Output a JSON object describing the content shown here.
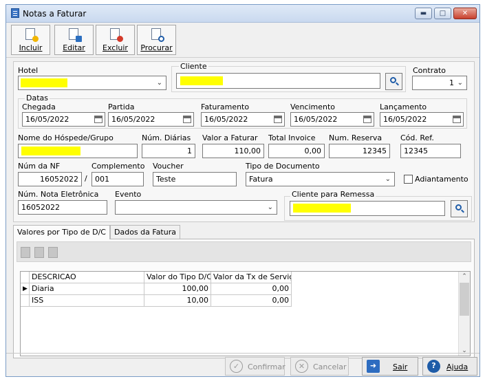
{
  "window": {
    "title": "Notas a Faturar",
    "minimize_icon": "minimize-icon",
    "maximize_icon": "maximize-icon",
    "close_icon": "close-icon"
  },
  "toolbar": {
    "incluir": "Incluir",
    "editar": "Editar",
    "excluir": "Excluir",
    "procurar": "Procurar"
  },
  "form": {
    "hotel_label": "Hotel",
    "cliente_label": "Cliente",
    "contrato_label": "Contrato",
    "contrato_value": "1",
    "datas_label": "Datas",
    "chegada_label": "Chegada",
    "chegada_value": "16/05/2022",
    "partida_label": "Partida",
    "partida_value": "16/05/2022",
    "faturamento_label": "Faturamento",
    "faturamento_value": "16/05/2022",
    "vencimento_label": "Vencimento",
    "vencimento_value": "16/05/2022",
    "lancamento_label": "Lançamento",
    "lancamento_value": "16/05/2022",
    "hospede_label": "Nome do Hóspede/Grupo",
    "diarias_label": "Núm. Diárias",
    "diarias_value": "1",
    "valor_label": "Valor a Faturar",
    "valor_value": "110,00",
    "total_label": "Total Invoice",
    "total_value": "0,00",
    "reserva_label": "Num. Reserva",
    "reserva_value": "12345",
    "codref_label": "Cód. Ref.",
    "codref_value": "12345",
    "nf_label": "Núm da NF",
    "nf_value": "16052022",
    "slash": "/",
    "complemento_label": "Complemento",
    "complemento_value": "001",
    "voucher_label": "Voucher",
    "voucher_value": "Teste",
    "tipo_doc_label": "Tipo de Documento",
    "tipo_doc_value": "Fatura",
    "adiantamento_label": "Adiantamento",
    "nota_eletronica_label": "Núm. Nota Eletrônica",
    "nota_eletronica_value": "16052022",
    "evento_label": "Evento",
    "cliente_remessa_label": "Cliente para Remessa"
  },
  "tabs": {
    "tab1": "Valores por Tipo de D/C",
    "tab2": "Dados da Fatura"
  },
  "grid": {
    "headers": [
      "DESCRICAO",
      "Valor do Tipo D/C",
      "Valor da Tx de Serviço"
    ],
    "rows": [
      {
        "descricao": "Diaria",
        "valor": "100,00",
        "taxa": "0,00"
      },
      {
        "descricao": "ISS",
        "valor": "10,00",
        "taxa": "0,00"
      }
    ]
  },
  "buttons": {
    "confirmar": "Confirmar",
    "cancelar": "Cancelar",
    "sair": "Sair",
    "ajuda": "Ajuda"
  },
  "colors": {
    "redaction": "#ffff00",
    "accent": "#1e5ca8"
  }
}
